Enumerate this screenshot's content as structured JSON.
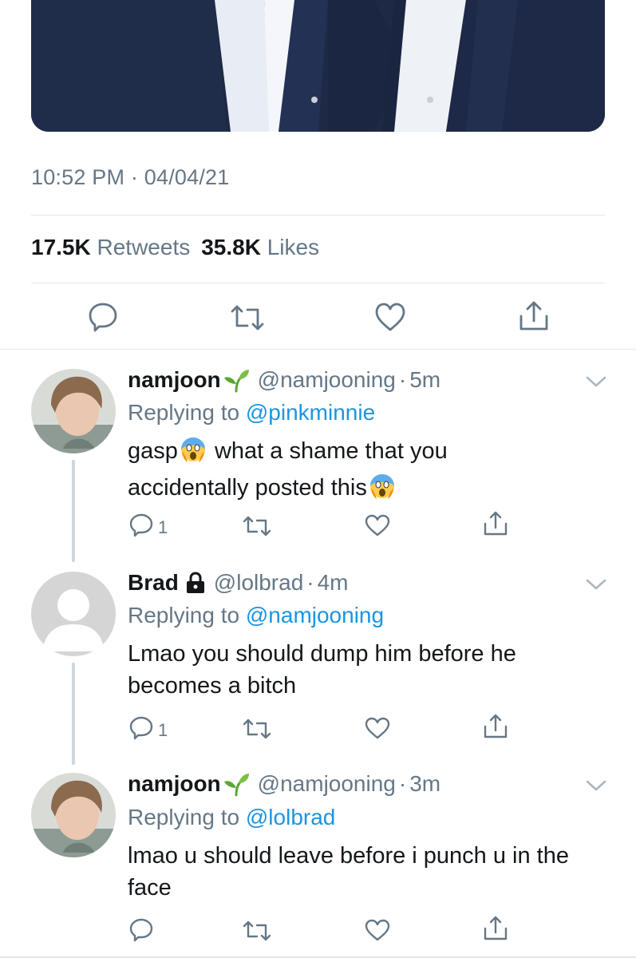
{
  "tweet": {
    "timestamp": "10:52 PM · 04/04/21",
    "retweets_count": "17.5K",
    "retweets_label": "Retweets",
    "likes_count": "35.8K",
    "likes_label": "Likes"
  },
  "replies": [
    {
      "display_name": "namjoon",
      "badge_emoji": "seedling",
      "handle": "@namjooning",
      "separator": "·",
      "age": "5m",
      "replying_prefix": "Replying to",
      "replying_to": "@pinkminnie",
      "line1_a": "gasp",
      "line1_b": "what a shame that you",
      "line2_a": "accidentally posted this",
      "reply_count": "1"
    },
    {
      "display_name": "Brad",
      "badge_icon": "lock-icon",
      "handle": "@lolbrad",
      "separator": "·",
      "age": "4m",
      "replying_prefix": "Replying to",
      "replying_to": "@namjooning",
      "line1": "Lmao you should dump him before he",
      "line2": "becomes a bitch",
      "reply_count": "1"
    },
    {
      "display_name": "namjoon",
      "badge_emoji": "seedling",
      "handle": "@namjooning",
      "separator": "·",
      "age": "3m",
      "replying_prefix": "Replying to",
      "replying_to": "@lolbrad",
      "line1": "lmao u should leave before i punch u in the",
      "line2": "face"
    }
  ],
  "colors": {
    "text": "#14171a",
    "secondary": "#657786",
    "link": "#1b95e0",
    "divider": "#e1e8ed",
    "thread_line": "#ccd6dd"
  }
}
